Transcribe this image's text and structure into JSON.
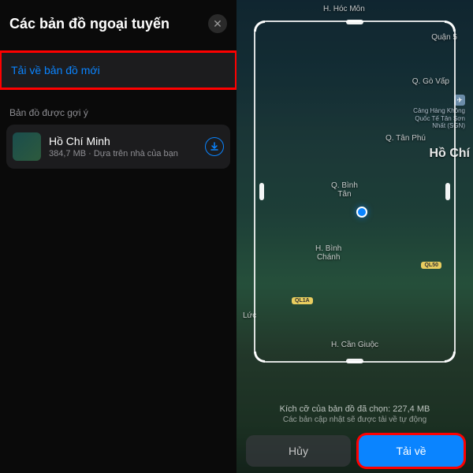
{
  "left": {
    "title": "Các bản đồ ngoại tuyến",
    "download_new": "Tải về bản đồ mới",
    "section_suggested": "Bản đồ được gợi ý",
    "suggested": {
      "name": "Hồ Chí Minh",
      "sub": "384,7 MB · Dựa trên nhà của bạn"
    }
  },
  "map": {
    "labels": {
      "hocmon": "H. Hóc Môn",
      "quan5": "Quận 5",
      "govap": "Q. Gò Vấp",
      "tanphu": "Q. Tân Phú",
      "city": "Hồ Chí",
      "binhtan": "Q. Bình\nTân",
      "binhchanh": "H. Bình\nChánh",
      "luc": "Lức",
      "cangiuoc": "H. Cần Giuộc"
    },
    "airport": {
      "line1": "Cảng Hàng Không",
      "line2": "Quốc Tế Tân Sơn",
      "line3": "Nhất (SGN)"
    },
    "routes": {
      "ql50": "QL50",
      "ql1a": "QL1A"
    }
  },
  "bottom": {
    "size": "Kích cỡ của bản đồ đã chọn: 227,4 MB",
    "updates": "Các bản cập nhật sẽ được tải về tự động",
    "cancel": "Hủy",
    "download": "Tải về"
  }
}
